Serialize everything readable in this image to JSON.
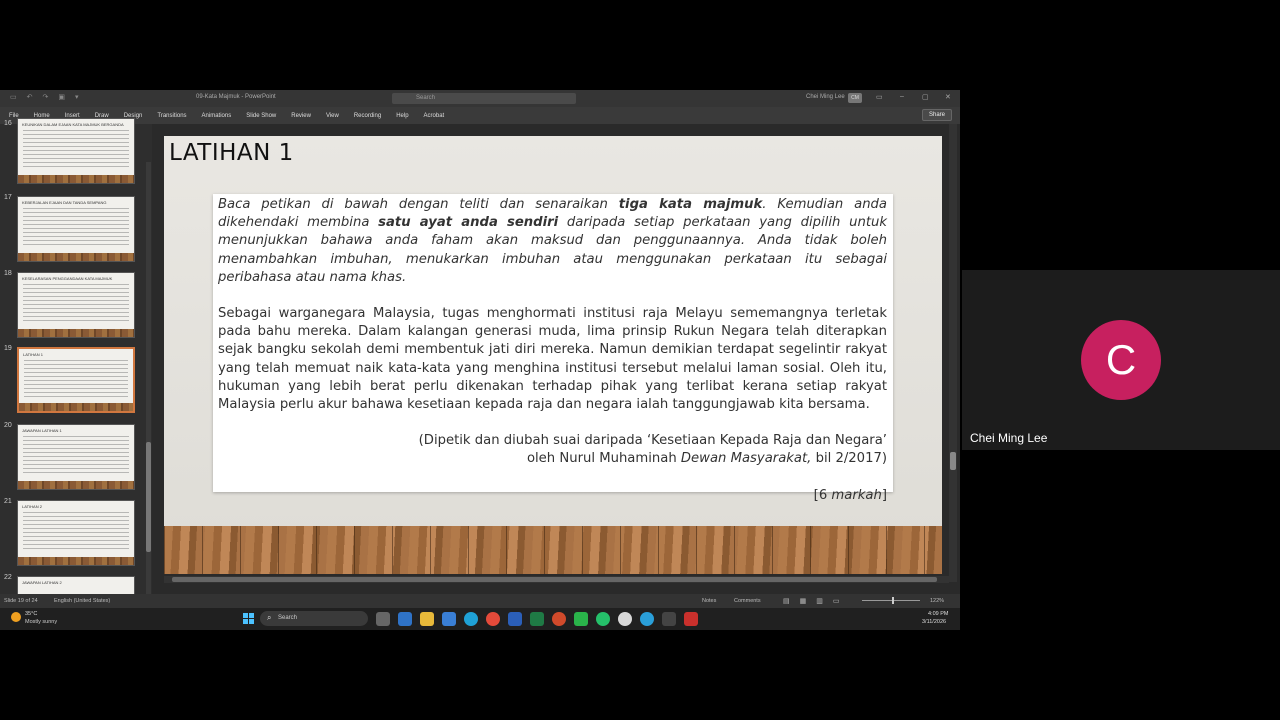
{
  "powerpoint": {
    "title_bar": {
      "doc_title": "09-Kata Majmuk  -  PowerPoint",
      "search_placeholder": "Search",
      "user_name": "Chei Ming Lee",
      "user_initials": "CM"
    },
    "ribbon_tabs": [
      "File",
      "Home",
      "Insert",
      "Draw",
      "Design",
      "Transitions",
      "Animations",
      "Slide Show",
      "Review",
      "View",
      "Recording",
      "Help",
      "Acrobat"
    ],
    "share_label": "Share",
    "thumbnails": [
      {
        "number": "16",
        "title": "KEUNIKAN DALAM EJAAN KATA MAJMUK BERGANDA"
      },
      {
        "number": "17",
        "title": "KEBERJALAN EJAAN DAN TANDA SEMPANG"
      },
      {
        "number": "18",
        "title": "KESELARASAN PENGGANDAAN KATA MAJMUK"
      },
      {
        "number": "19",
        "title": "LATIHAN 1"
      },
      {
        "number": "20",
        "title": "JAWAPAN LATIHAN 1"
      },
      {
        "number": "21",
        "title": "LATIHAN 2"
      },
      {
        "number": "22",
        "title": "JAWAPAN LATIHAN 2"
      }
    ],
    "slide": {
      "title": "LATIHAN 1",
      "instruction": {
        "part1": "Baca petikan di bawah dengan teliti dan senaraikan ",
        "bold1": "tiga kata majmuk",
        "part2": ". Kemudian anda dikehendaki membina ",
        "bold2": "satu ayat anda sendiri",
        "part3": " daripada setiap perkataan yang dipilih untuk menunjukkan bahawa anda faham akan maksud dan penggunaannya. Anda tidak boleh menambahkan imbuhan, menukarkan imbuhan atau menggunakan perkataan itu sebagai peribahasa atau nama khas."
      },
      "passage": "Sebagai warganegara Malaysia, tugas menghormati institusi raja Melayu sememangnya terletak pada bahu mereka. Dalam kalangan generasi muda, lima prinsip Rukun Negara telah diterapkan sejak bangku sekolah demi membentuk jati diri mereka. Namun demikian terdapat segelintir rakyat yang telah memuat naik kata-kata yang menghina institusi tersebut melalui laman sosial. Oleh itu, hukuman yang lebih berat perlu dikenakan terhadap pihak yang terlibat kerana setiap rakyat Malaysia perlu akur bahawa kesetiaan kepada raja dan negara ialah tanggungjawab kita bersama.",
      "source_line1": "(Dipetik dan diubah suai daripada ‘Kesetiaan Kepada Raja dan Negara’",
      "source_line2_prefix": "oleh Nurul Muhaminah ",
      "source_line2_italic": "Dewan Masyarakat,",
      "source_line2_suffix": " bil 2/2017)",
      "marks_open": "[6 ",
      "marks_italic": "markah",
      "marks_close": "]"
    },
    "status_bar": {
      "slide_of": "Slide 19 of 24",
      "language": "English (United States)",
      "notes": "Notes",
      "comments": "Comments",
      "zoom": "122%"
    }
  },
  "taskbar": {
    "weather_temp": "35°C",
    "weather_condition": "Mostly sunny",
    "search_label": "Search",
    "time": "4:09 PM",
    "date": "3/11/2026"
  },
  "participant": {
    "initial": "C",
    "name": "Chei Ming Lee",
    "avatar_color": "#c7205f"
  }
}
